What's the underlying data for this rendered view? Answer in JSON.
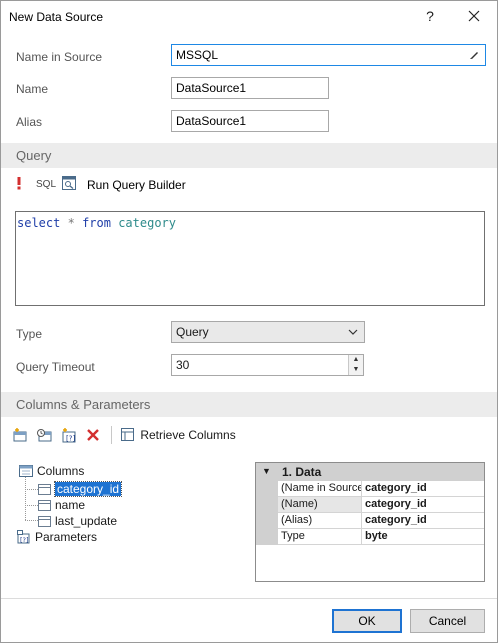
{
  "window": {
    "title": "New Data Source",
    "help_label": "?"
  },
  "form": {
    "name_in_source_label": "Name in Source",
    "name_in_source_value": "MSSQL",
    "name_label": "Name",
    "name_value": "DataSource1",
    "alias_label": "Alias",
    "alias_value": "DataSource1"
  },
  "query_section": {
    "title": "Query",
    "toolbar": {
      "sql_label": "SQL",
      "run_builder_label": "Run Query Builder"
    },
    "editor": {
      "kw1": "select",
      "op": "*",
      "kw2": "from",
      "table": "category"
    },
    "type_label": "Type",
    "type_value": "Query",
    "timeout_label": "Query Timeout",
    "timeout_value": "30"
  },
  "columns_section": {
    "title": "Columns & Parameters",
    "toolbar": {
      "retrieve_label": "Retrieve Columns"
    },
    "tree": {
      "columns_label": "Columns",
      "items": [
        "category_id",
        "name",
        "last_update"
      ],
      "parameters_label": "Parameters"
    },
    "properties": {
      "group_title": "1. Data",
      "rows": [
        {
          "key": "(Name in Source",
          "value": "category_id"
        },
        {
          "key": "(Name)",
          "value": "category_id"
        },
        {
          "key": "(Alias)",
          "value": "category_id"
        },
        {
          "key": "Type",
          "value": "byte"
        }
      ]
    }
  },
  "footer": {
    "ok_label": "OK",
    "cancel_label": "Cancel"
  },
  "colors": {
    "accent": "#1e73d2",
    "section_bg": "#ececec",
    "error_icon": "#d32f2f"
  }
}
